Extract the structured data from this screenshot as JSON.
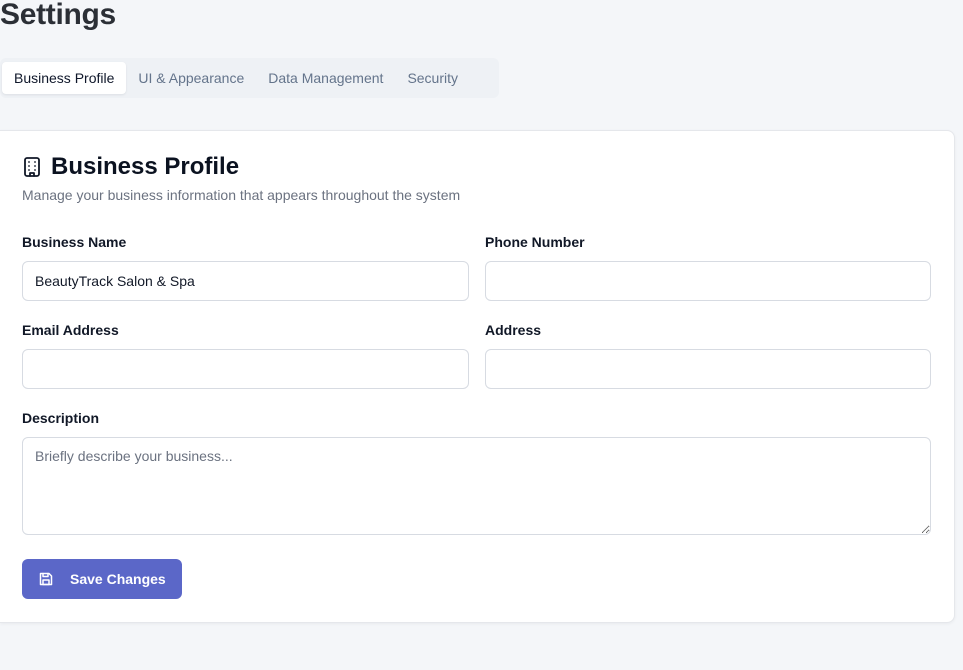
{
  "page": {
    "title": "Settings"
  },
  "tabs": [
    {
      "label": "Business Profile",
      "active": true
    },
    {
      "label": "UI & Appearance",
      "active": false
    },
    {
      "label": "Data Management",
      "active": false
    },
    {
      "label": "Security",
      "active": false
    }
  ],
  "card": {
    "icon": "building-icon",
    "title": "Business Profile",
    "subtitle": "Manage your business information that appears throughout the system"
  },
  "form": {
    "business_name": {
      "label": "Business Name",
      "value": "BeautyTrack Salon & Spa",
      "placeholder": ""
    },
    "phone_number": {
      "label": "Phone Number",
      "value": "",
      "placeholder": ""
    },
    "email_address": {
      "label": "Email Address",
      "value": "",
      "placeholder": ""
    },
    "address": {
      "label": "Address",
      "value": "",
      "placeholder": ""
    },
    "description": {
      "label": "Description",
      "value": "",
      "placeholder": "Briefly describe your business..."
    }
  },
  "actions": {
    "save_label": "Save Changes",
    "save_icon": "save-icon"
  },
  "colors": {
    "accent": "#5b67c8",
    "background": "#f4f6f9",
    "muted_text": "#6b7280"
  }
}
